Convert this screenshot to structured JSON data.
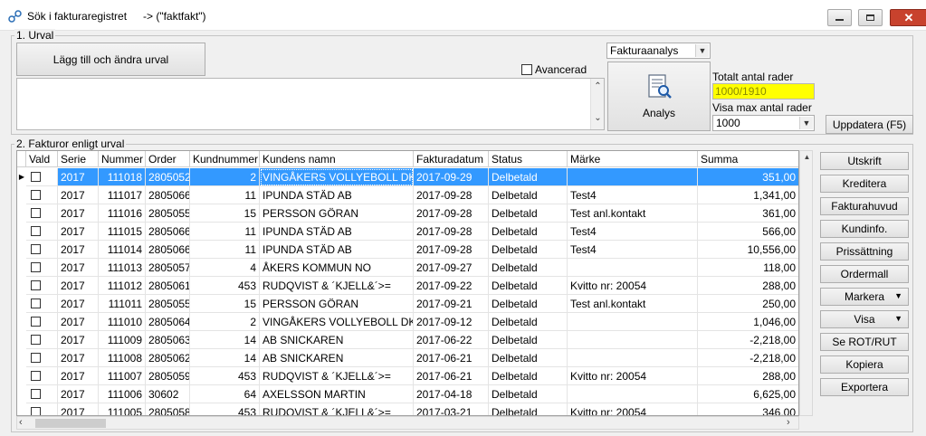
{
  "window": {
    "title": "Sök i fakturaregistret",
    "subtitle": "-> (\"faktfakt\")"
  },
  "urval": {
    "legend": "1. Urval",
    "add_button": "Lägg till och ändra urval",
    "advanced_label": "Avancerad",
    "analysis_select": "Fakturaanalys",
    "analys_button": "Analys",
    "total_rows_label": "Totalt antal rader",
    "total_rows_value": "1000/1910",
    "max_rows_label": "Visa max antal rader",
    "max_rows_value": "1000",
    "update_button": "Uppdatera (F5)"
  },
  "invoices": {
    "legend": "2. Fakturor enligt urval",
    "columns": [
      "Vald",
      "Serie",
      "Nummer",
      "Order",
      "Kundnummer",
      "Kundens namn",
      "Fakturadatum",
      "Status",
      "Märke",
      "Summa"
    ],
    "rows": [
      {
        "serie": "2017",
        "nummer": "111018",
        "order": "2805052",
        "kund": "2",
        "namn": "VINGÅKERS VOLLYEBOLL DK´",
        "datum": "2017-09-29",
        "status": "Delbetald",
        "marke": "",
        "summa": "351,00"
      },
      {
        "serie": "2017",
        "nummer": "111017",
        "order": "2805066",
        "kund": "11",
        "namn": "IPUNDA STÄD AB",
        "datum": "2017-09-28",
        "status": "Delbetald",
        "marke": "Test4",
        "summa": "1,341,00"
      },
      {
        "serie": "2017",
        "nummer": "111016",
        "order": "2805055",
        "kund": "15",
        "namn": "PERSSON GÖRAN",
        "datum": "2017-09-28",
        "status": "Delbetald",
        "marke": "Test anl.kontakt",
        "summa": "361,00"
      },
      {
        "serie": "2017",
        "nummer": "111015",
        "order": "2805066",
        "kund": "11",
        "namn": "IPUNDA STÄD AB",
        "datum": "2017-09-28",
        "status": "Delbetald",
        "marke": "Test4",
        "summa": "566,00"
      },
      {
        "serie": "2017",
        "nummer": "111014",
        "order": "2805066",
        "kund": "11",
        "namn": "IPUNDA STÄD AB",
        "datum": "2017-09-28",
        "status": "Delbetald",
        "marke": "Test4",
        "summa": "10,556,00"
      },
      {
        "serie": "2017",
        "nummer": "111013",
        "order": "2805057",
        "kund": "4",
        "namn": "ÅKERS KOMMUN NO",
        "datum": "2017-09-27",
        "status": "Delbetald",
        "marke": "",
        "summa": "118,00"
      },
      {
        "serie": "2017",
        "nummer": "111012",
        "order": "2805061",
        "kund": "453",
        "namn": "RUDQVIST & ´KJELL&´>=",
        "datum": "2017-09-22",
        "status": "Delbetald",
        "marke": "Kvitto nr: 20054",
        "summa": "288,00"
      },
      {
        "serie": "2017",
        "nummer": "111011",
        "order": "2805055",
        "kund": "15",
        "namn": "PERSSON GÖRAN",
        "datum": "2017-09-21",
        "status": "Delbetald",
        "marke": "Test anl.kontakt",
        "summa": "250,00"
      },
      {
        "serie": "2017",
        "nummer": "111010",
        "order": "2805064",
        "kund": "2",
        "namn": "VINGÅKERS VOLLYEBOLL DK´",
        "datum": "2017-09-12",
        "status": "Delbetald",
        "marke": "",
        "summa": "1,046,00"
      },
      {
        "serie": "2017",
        "nummer": "111009",
        "order": "2805063",
        "kund": "14",
        "namn": "AB SNICKAREN",
        "datum": "2017-06-22",
        "status": "Delbetald",
        "marke": "",
        "summa": "-2,218,00"
      },
      {
        "serie": "2017",
        "nummer": "111008",
        "order": "2805062",
        "kund": "14",
        "namn": "AB SNICKAREN",
        "datum": "2017-06-21",
        "status": "Delbetald",
        "marke": "",
        "summa": "-2,218,00"
      },
      {
        "serie": "2017",
        "nummer": "111007",
        "order": "2805059",
        "kund": "453",
        "namn": "RUDQVIST & ´KJELL&´>=",
        "datum": "2017-06-21",
        "status": "Delbetald",
        "marke": "Kvitto nr: 20054",
        "summa": "288,00"
      },
      {
        "serie": "2017",
        "nummer": "111006",
        "order": "30602",
        "kund": "64",
        "namn": "AXELSSON MARTIN",
        "datum": "2017-04-18",
        "status": "Delbetald",
        "marke": "",
        "summa": "6,625,00"
      },
      {
        "serie": "2017",
        "nummer": "111005",
        "order": "2805058",
        "kund": "453",
        "namn": "RUDQVIST & ´KJELL&´>=",
        "datum": "2017-03-21",
        "status": "Delbetald",
        "marke": "Kvitto nr: 20054",
        "summa": "346,00"
      }
    ]
  },
  "actions": {
    "utskrift": "Utskrift",
    "kreditera": "Kreditera",
    "fakturahuvud": "Fakturahuvud",
    "kundinfo": "Kundinfo.",
    "prissattning": "Prissättning",
    "ordermall": "Ordermall",
    "markera": "Markera",
    "visa": "Visa",
    "se_rot_rut": "Se ROT/RUT",
    "kopiera": "Kopiera",
    "exportera": "Exportera"
  },
  "colors": {
    "selection": "#3399ff",
    "total_highlight": "#ffff00",
    "close_button": "#c8422d"
  }
}
